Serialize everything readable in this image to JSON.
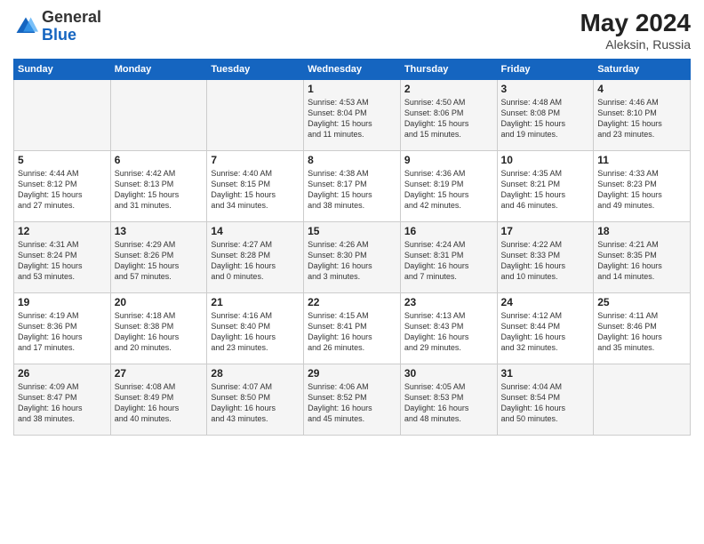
{
  "header": {
    "logo_general": "General",
    "logo_blue": "Blue",
    "month_title": "May 2024",
    "location": "Aleksin, Russia"
  },
  "days_of_week": [
    "Sunday",
    "Monday",
    "Tuesday",
    "Wednesday",
    "Thursday",
    "Friday",
    "Saturday"
  ],
  "weeks": [
    [
      {
        "day": "",
        "info": ""
      },
      {
        "day": "",
        "info": ""
      },
      {
        "day": "",
        "info": ""
      },
      {
        "day": "1",
        "info": "Sunrise: 4:53 AM\nSunset: 8:04 PM\nDaylight: 15 hours\nand 11 minutes."
      },
      {
        "day": "2",
        "info": "Sunrise: 4:50 AM\nSunset: 8:06 PM\nDaylight: 15 hours\nand 15 minutes."
      },
      {
        "day": "3",
        "info": "Sunrise: 4:48 AM\nSunset: 8:08 PM\nDaylight: 15 hours\nand 19 minutes."
      },
      {
        "day": "4",
        "info": "Sunrise: 4:46 AM\nSunset: 8:10 PM\nDaylight: 15 hours\nand 23 minutes."
      }
    ],
    [
      {
        "day": "5",
        "info": "Sunrise: 4:44 AM\nSunset: 8:12 PM\nDaylight: 15 hours\nand 27 minutes."
      },
      {
        "day": "6",
        "info": "Sunrise: 4:42 AM\nSunset: 8:13 PM\nDaylight: 15 hours\nand 31 minutes."
      },
      {
        "day": "7",
        "info": "Sunrise: 4:40 AM\nSunset: 8:15 PM\nDaylight: 15 hours\nand 34 minutes."
      },
      {
        "day": "8",
        "info": "Sunrise: 4:38 AM\nSunset: 8:17 PM\nDaylight: 15 hours\nand 38 minutes."
      },
      {
        "day": "9",
        "info": "Sunrise: 4:36 AM\nSunset: 8:19 PM\nDaylight: 15 hours\nand 42 minutes."
      },
      {
        "day": "10",
        "info": "Sunrise: 4:35 AM\nSunset: 8:21 PM\nDaylight: 15 hours\nand 46 minutes."
      },
      {
        "day": "11",
        "info": "Sunrise: 4:33 AM\nSunset: 8:23 PM\nDaylight: 15 hours\nand 49 minutes."
      }
    ],
    [
      {
        "day": "12",
        "info": "Sunrise: 4:31 AM\nSunset: 8:24 PM\nDaylight: 15 hours\nand 53 minutes."
      },
      {
        "day": "13",
        "info": "Sunrise: 4:29 AM\nSunset: 8:26 PM\nDaylight: 15 hours\nand 57 minutes."
      },
      {
        "day": "14",
        "info": "Sunrise: 4:27 AM\nSunset: 8:28 PM\nDaylight: 16 hours\nand 0 minutes."
      },
      {
        "day": "15",
        "info": "Sunrise: 4:26 AM\nSunset: 8:30 PM\nDaylight: 16 hours\nand 3 minutes."
      },
      {
        "day": "16",
        "info": "Sunrise: 4:24 AM\nSunset: 8:31 PM\nDaylight: 16 hours\nand 7 minutes."
      },
      {
        "day": "17",
        "info": "Sunrise: 4:22 AM\nSunset: 8:33 PM\nDaylight: 16 hours\nand 10 minutes."
      },
      {
        "day": "18",
        "info": "Sunrise: 4:21 AM\nSunset: 8:35 PM\nDaylight: 16 hours\nand 14 minutes."
      }
    ],
    [
      {
        "day": "19",
        "info": "Sunrise: 4:19 AM\nSunset: 8:36 PM\nDaylight: 16 hours\nand 17 minutes."
      },
      {
        "day": "20",
        "info": "Sunrise: 4:18 AM\nSunset: 8:38 PM\nDaylight: 16 hours\nand 20 minutes."
      },
      {
        "day": "21",
        "info": "Sunrise: 4:16 AM\nSunset: 8:40 PM\nDaylight: 16 hours\nand 23 minutes."
      },
      {
        "day": "22",
        "info": "Sunrise: 4:15 AM\nSunset: 8:41 PM\nDaylight: 16 hours\nand 26 minutes."
      },
      {
        "day": "23",
        "info": "Sunrise: 4:13 AM\nSunset: 8:43 PM\nDaylight: 16 hours\nand 29 minutes."
      },
      {
        "day": "24",
        "info": "Sunrise: 4:12 AM\nSunset: 8:44 PM\nDaylight: 16 hours\nand 32 minutes."
      },
      {
        "day": "25",
        "info": "Sunrise: 4:11 AM\nSunset: 8:46 PM\nDaylight: 16 hours\nand 35 minutes."
      }
    ],
    [
      {
        "day": "26",
        "info": "Sunrise: 4:09 AM\nSunset: 8:47 PM\nDaylight: 16 hours\nand 38 minutes."
      },
      {
        "day": "27",
        "info": "Sunrise: 4:08 AM\nSunset: 8:49 PM\nDaylight: 16 hours\nand 40 minutes."
      },
      {
        "day": "28",
        "info": "Sunrise: 4:07 AM\nSunset: 8:50 PM\nDaylight: 16 hours\nand 43 minutes."
      },
      {
        "day": "29",
        "info": "Sunrise: 4:06 AM\nSunset: 8:52 PM\nDaylight: 16 hours\nand 45 minutes."
      },
      {
        "day": "30",
        "info": "Sunrise: 4:05 AM\nSunset: 8:53 PM\nDaylight: 16 hours\nand 48 minutes."
      },
      {
        "day": "31",
        "info": "Sunrise: 4:04 AM\nSunset: 8:54 PM\nDaylight: 16 hours\nand 50 minutes."
      },
      {
        "day": "",
        "info": ""
      }
    ]
  ]
}
